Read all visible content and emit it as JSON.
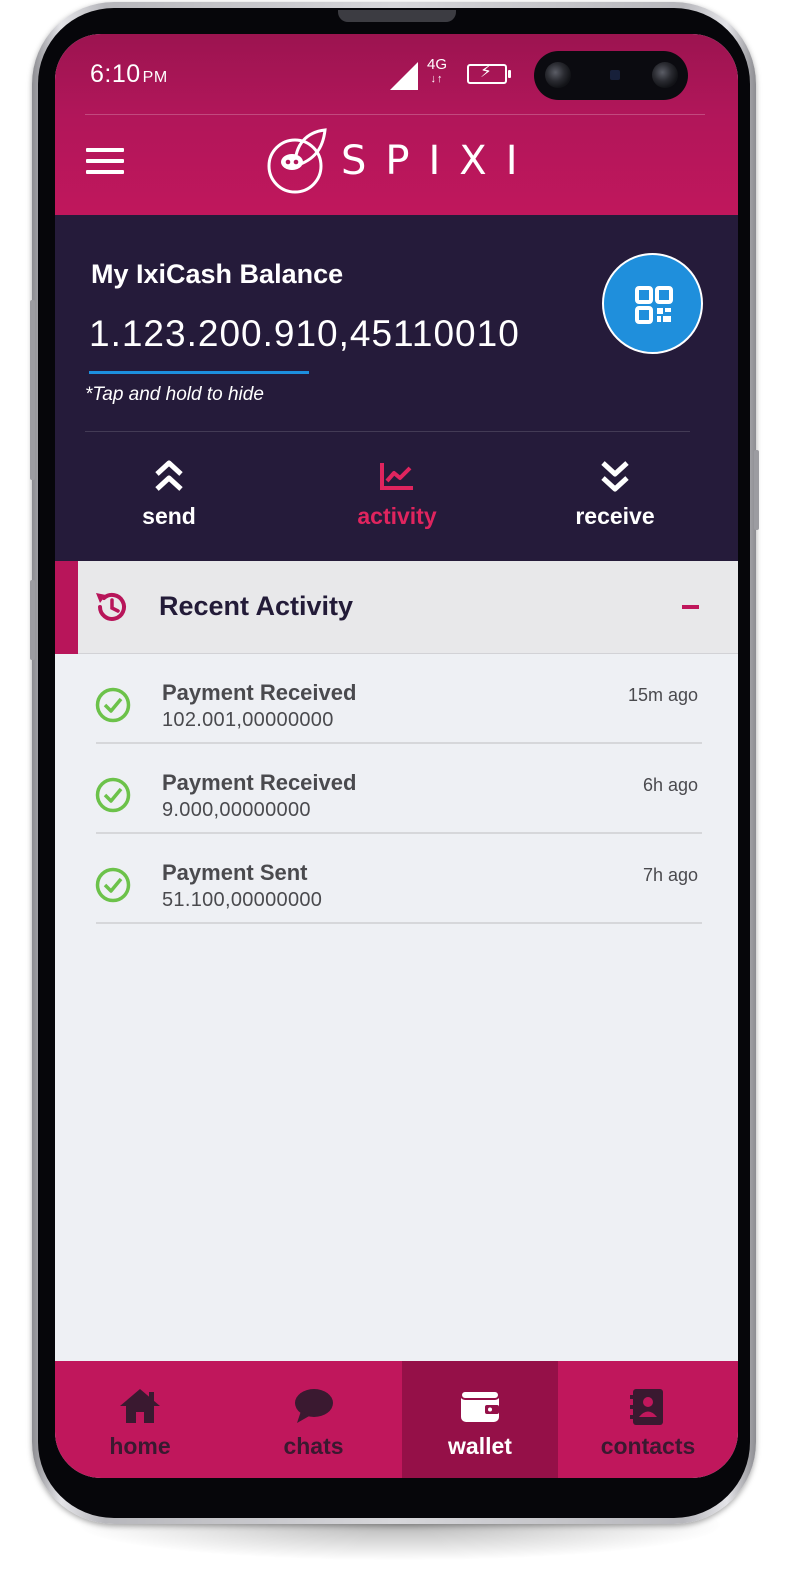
{
  "status_bar": {
    "time": "6:10",
    "ampm": "PM",
    "network": "4G",
    "network_arrows": "↓↑"
  },
  "header": {
    "menu_icon": "hamburger-menu-icon",
    "logo_text": "SPIXI"
  },
  "balance": {
    "title": "My IxiCash Balance",
    "amount": "1.123.200.910,45110010",
    "hint": "*Tap and hold to hide",
    "qr_icon": "qr-code-icon"
  },
  "actions": [
    {
      "label": "send",
      "icon": "double-chevron-up-icon",
      "active": false
    },
    {
      "label": "activity",
      "icon": "chart-icon",
      "active": true
    },
    {
      "label": "receive",
      "icon": "double-chevron-down-icon",
      "active": false
    }
  ],
  "recent_activity": {
    "title": "Recent Activity",
    "icon": "history-icon",
    "collapse_icon": "minus-icon",
    "items": [
      {
        "type": "Payment Received",
        "amount": "102.001,00000000",
        "time": "15m ago",
        "status_icon": "check-circle-icon"
      },
      {
        "type": "Payment Received",
        "amount": "9.000,00000000",
        "time": "6h ago",
        "status_icon": "check-circle-icon"
      },
      {
        "type": "Payment Sent",
        "amount": "51.100,00000000",
        "time": "7h ago",
        "status_icon": "check-circle-icon"
      }
    ]
  },
  "bottom_nav": [
    {
      "label": "home",
      "icon": "home-icon",
      "active": false
    },
    {
      "label": "chats",
      "icon": "chat-bubble-icon",
      "active": false
    },
    {
      "label": "wallet",
      "icon": "wallet-icon",
      "active": true
    },
    {
      "label": "contacts",
      "icon": "contacts-book-icon",
      "active": false
    }
  ],
  "colors": {
    "brand": "#c0175c",
    "brand_dark": "#951048",
    "card_bg": "#251b3a",
    "accent_blue": "#1f8fdc",
    "active_pink": "#e0245e",
    "success_green": "#6cc24a"
  }
}
